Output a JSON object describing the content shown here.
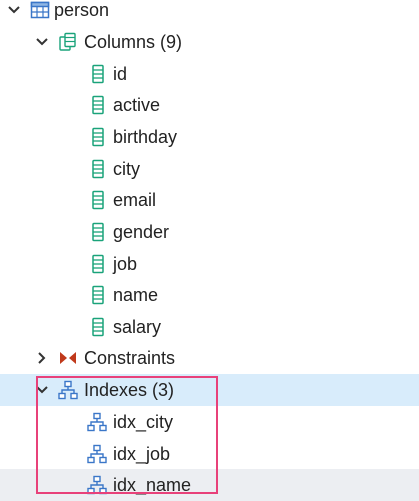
{
  "colors": {
    "selected_row": "#d8ecfb",
    "hover_row": "#eceef2",
    "highlight_border": "#e8417a",
    "column_icon": "#1aa37a",
    "index_icon": "#3a76c8",
    "constraint_icon": "#c0391b"
  },
  "tree": {
    "table": {
      "label": "person",
      "icon": "table-icon",
      "expanded": true
    },
    "columns": {
      "label": "Columns (9)",
      "icon": "columns-icon",
      "expanded": true,
      "items": [
        "id",
        "active",
        "birthday",
        "city",
        "email",
        "gender",
        "job",
        "name",
        "salary"
      ]
    },
    "constraints": {
      "label": "Constraints",
      "icon": "constraints-icon",
      "expanded": false
    },
    "indexes": {
      "label": "Indexes (3)",
      "icon": "index-icon",
      "expanded": true,
      "selected": true,
      "items": [
        "idx_city",
        "idx_job",
        "idx_name"
      ]
    }
  }
}
